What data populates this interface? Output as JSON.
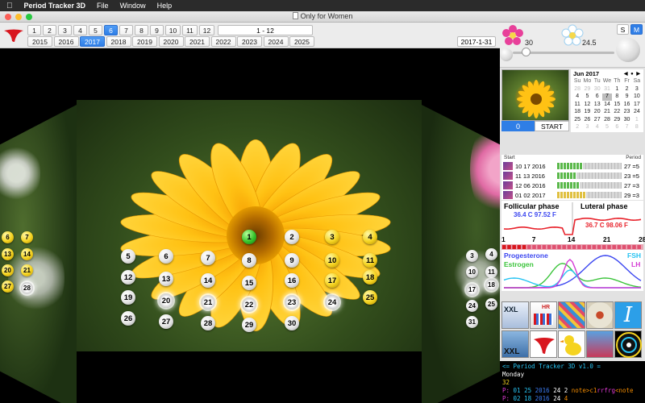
{
  "menubar": {
    "app_name": "Period Tracker 3D",
    "items": [
      "File",
      "Window",
      "Help"
    ]
  },
  "window": {
    "title": "Only for Women"
  },
  "toolbar": {
    "months": [
      "1",
      "2",
      "3",
      "4",
      "5",
      "6",
      "7",
      "8",
      "9",
      "10",
      "11",
      "12"
    ],
    "selected_month": "6",
    "years": [
      "2015",
      "2016",
      "2017",
      "2018",
      "2019",
      "2020",
      "2021",
      "2022",
      "2023",
      "2024",
      "2025"
    ],
    "selected_year": "2017",
    "range_label": "1 - 12",
    "current_date": "2017-1-31"
  },
  "controls": {
    "left_value": "30",
    "right_value": "24.5",
    "mode_s": "S",
    "mode_m": "M",
    "selected_mode": "M"
  },
  "calendar": {
    "title": "Jun 2017",
    "nav": "◀ ● ▶",
    "dow": [
      "Su",
      "Mo",
      "Tu",
      "We",
      "Th",
      "Fr",
      "Sa"
    ],
    "days": [
      "28",
      "29",
      "30",
      "31",
      "1",
      "2",
      "3",
      "4",
      "5",
      "6",
      "7",
      "8",
      "9",
      "10",
      "11",
      "12",
      "13",
      "14",
      "15",
      "16",
      "17",
      "18",
      "19",
      "20",
      "21",
      "22",
      "23",
      "24",
      "25",
      "26",
      "27",
      "28",
      "29",
      "30",
      "1",
      "2",
      "3",
      "4",
      "5",
      "6",
      "7",
      "8"
    ],
    "today": "7"
  },
  "counter": {
    "value": "0",
    "start_label": "START"
  },
  "history": {
    "col_start": "Start",
    "col_period": "Period",
    "rows": [
      {
        "date": "10 17 2016",
        "value": "27 =5",
        "fill": 0.4,
        "color": "#5ab84a"
      },
      {
        "date": "11 13 2016",
        "value": "23 =5",
        "fill": 0.3,
        "color": "#5ab84a"
      },
      {
        "date": "12 06 2016",
        "value": "27 =3",
        "fill": 0.35,
        "color": "#5ab84a"
      },
      {
        "date": "01 02 2017",
        "value": "29 =3",
        "fill": 0.45,
        "color": "#e0c040"
      }
    ]
  },
  "phase": {
    "follicular_label": "Follicular phase",
    "follicular_temp": "36.4 C  97.52 F",
    "luteral_label": "Luteral phase",
    "luteral_temp": "36.7 C  98.06 F",
    "axis": [
      "1",
      "7",
      "14",
      "21",
      "28"
    ],
    "progesterone": "Progesterone",
    "fsh": "FSH",
    "estrogen": "Estrogen",
    "lh": "LH",
    "colors": {
      "temp": "#e8232c",
      "progesterone": "#3b46f0",
      "estrogen": "#3bc43b",
      "fsh": "#27c3f2",
      "lh": "#d43ad4"
    }
  },
  "icons": {
    "row1": [
      "xxl-icon",
      "hr-icon",
      "grid-icon",
      "flower-icon",
      "italic-i-icon"
    ],
    "row2": [
      "xxl-box-icon",
      "logo-icon",
      "duck-icon",
      "gift-icon",
      "target-icon"
    ],
    "xxl_text": "XXL",
    "hr_text": "HR"
  },
  "console": {
    "line1": "<= Period Tracker 3D v1.0 =",
    "line2": "Monday",
    "line3": "32",
    "line4": {
      "prefix": "P: ",
      "date": "01 25",
      "year": "2016",
      "num": "24",
      "two": "2",
      "note_a": "note>c1",
      "note_b": "rrfrg",
      "note_c": "<note"
    },
    "line5": {
      "prefix": "P: ",
      "date": "02 18",
      "year": "2016",
      "num": "24",
      "four": "4"
    }
  },
  "calendar_balls": {
    "center": [
      {
        "n": "1",
        "type": "green"
      },
      {
        "n": "2"
      },
      {
        "n": "3",
        "type": "yellow"
      },
      {
        "n": "4",
        "type": "yellow"
      },
      {
        "n": "5"
      },
      {
        "n": "6"
      },
      {
        "n": "7"
      },
      {
        "n": "8"
      },
      {
        "n": "9"
      },
      {
        "n": "10",
        "type": "yellow"
      },
      {
        "n": "11",
        "type": "yellow"
      },
      {
        "n": "12"
      },
      {
        "n": "13"
      },
      {
        "n": "14"
      },
      {
        "n": "15"
      },
      {
        "n": "16"
      },
      {
        "n": "17",
        "type": "yellow"
      },
      {
        "n": "18",
        "type": "yellow"
      },
      {
        "n": "19"
      },
      {
        "n": "20",
        "type": "fancy"
      },
      {
        "n": "21",
        "type": "fancy"
      },
      {
        "n": "22",
        "type": "fancy"
      },
      {
        "n": "23",
        "type": "fancy"
      },
      {
        "n": "24",
        "type": "fancy"
      },
      {
        "n": "25",
        "type": "yellow"
      },
      {
        "n": "26"
      },
      {
        "n": "27"
      },
      {
        "n": "28"
      },
      {
        "n": "29"
      },
      {
        "n": "30"
      }
    ],
    "left": [
      {
        "n": "6",
        "type": "yellow"
      },
      {
        "n": "7",
        "type": "yellow"
      },
      {
        "n": "13",
        "type": "yellow"
      },
      {
        "n": "14",
        "type": "yellow"
      },
      {
        "n": "20",
        "type": "yellow"
      },
      {
        "n": "21",
        "type": "yellow"
      },
      {
        "n": "27",
        "type": "yellow"
      },
      {
        "n": "28",
        "type": "fancy"
      }
    ],
    "right": [
      {
        "n": "3"
      },
      {
        "n": "4"
      },
      {
        "n": "10"
      },
      {
        "n": "11"
      },
      {
        "n": "17",
        "type": "fancy"
      },
      {
        "n": "18",
        "type": "fancy"
      },
      {
        "n": "24"
      },
      {
        "n": "25"
      },
      {
        "n": "31"
      }
    ]
  }
}
